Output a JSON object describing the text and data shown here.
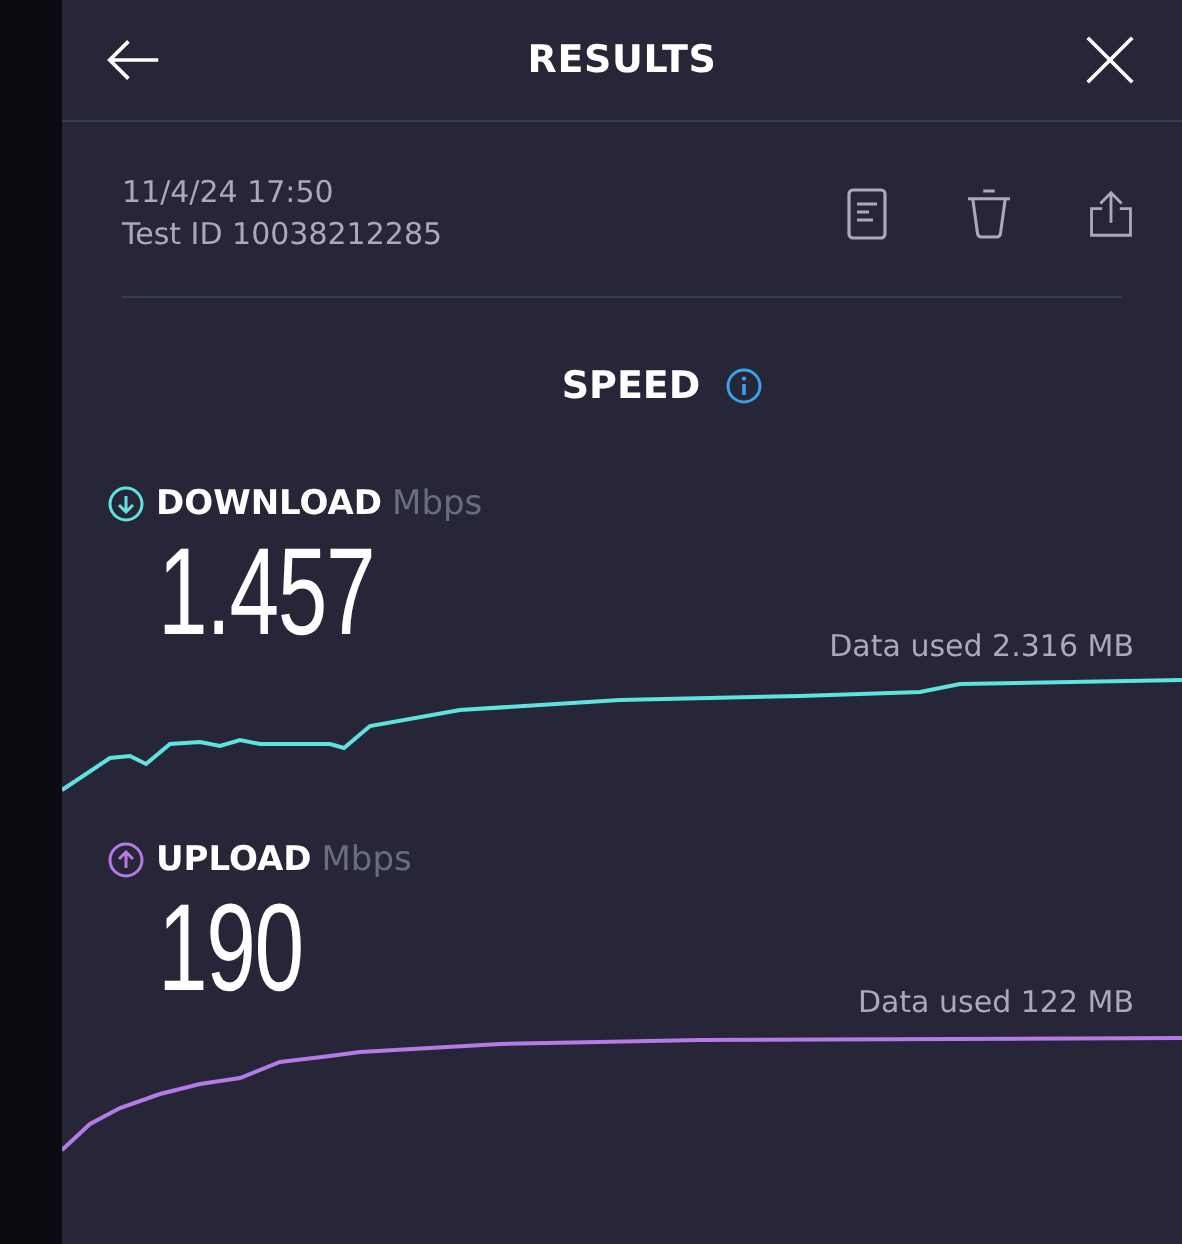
{
  "header": {
    "title": "RESULTS"
  },
  "test": {
    "datetime": "11/4/24 17:50",
    "test_id": "Test ID 10038212285"
  },
  "speed": {
    "title": "SPEED"
  },
  "sections": [
    {
      "kind": "download",
      "label": "DOWNLOAD",
      "unit": "Mbps",
      "value": "1.457",
      "data_used": "Data used 2.316 MB",
      "color": "#5ee3e0"
    },
    {
      "kind": "upload",
      "label": "UPLOAD",
      "unit": "Mbps",
      "value": "190",
      "data_used": "Data used 122 MB",
      "color": "#b67ae6"
    }
  ]
}
